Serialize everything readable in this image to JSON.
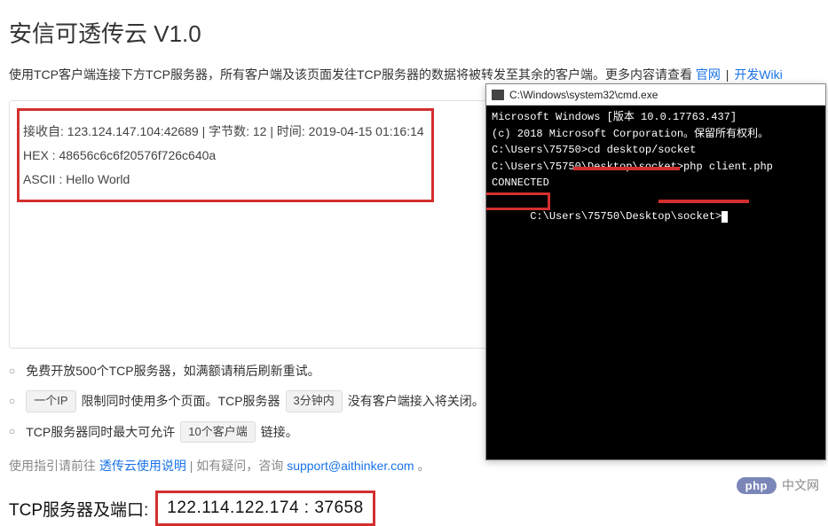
{
  "header": {
    "title": "安信可透传云 V1.0",
    "desc_prefix": "使用TCP客户端连接下方TCP服务器，所有客户端及该页面发往TCP服务器的数据将被转发至其余的客户端。更多内容请查看 ",
    "link1": "官网",
    "separator": "|",
    "link2": "开发Wiki"
  },
  "received": {
    "line1": "接收自: 123.124.147.104:42689 | 字节数: 12 | 时间: 2019-04-15 01:16:14",
    "line2": "HEX   : 48656c6c6f20576f726c640a",
    "line3": "ASCII : Hello World"
  },
  "notes": {
    "item1_prefix": "免费开放500个TCP服务器，如满额请稍后刷新重试。",
    "item2_pill": "一个IP",
    "item2_mid": "限制同时使用多个页面。TCP服务器",
    "item2_pill2": "3分钟内",
    "item2_suffix": "没有客户端接入将关闭。",
    "item3_prefix": "TCP服务器同时最大可允许",
    "item3_pill": "10个客户端",
    "item3_suffix": "链接。"
  },
  "guide": {
    "prefix": "使用指引请前往 ",
    "link": "透传云使用说明",
    "mid": " | 如有疑问，咨询 ",
    "email": "support@aithinker.com",
    "suffix": "。"
  },
  "server": {
    "label": "TCP服务器及端口:",
    "value": "122.114.122.174 : 37658"
  },
  "cmd": {
    "title": "C:\\Windows\\system32\\cmd.exe",
    "lines": {
      "l1": "Microsoft Windows [版本 10.0.17763.437]",
      "l2": "(c) 2018 Microsoft Corporation。保留所有权利。",
      "l3": "",
      "l4": "C:\\Users\\75750>cd desktop/socket",
      "l5": "",
      "l6": "C:\\Users\\75750\\Desktop\\socket>php client.php",
      "l7": "CONNECTED",
      "l8": "C:\\Users\\75750\\Desktop\\socket>"
    }
  },
  "badge": {
    "pill": "php",
    "text": "中文网"
  }
}
